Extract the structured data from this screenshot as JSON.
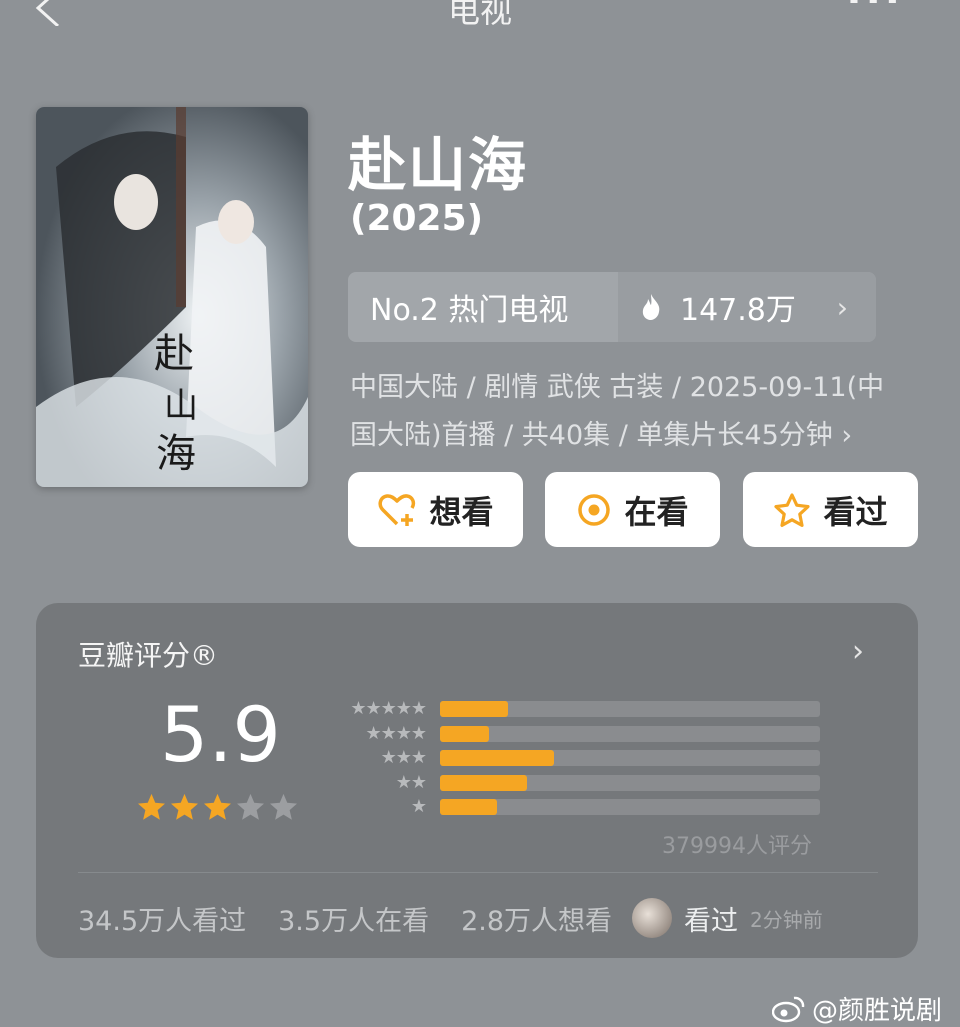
{
  "nav": {
    "title": "电视",
    "more": "···"
  },
  "show": {
    "title": "赴山海",
    "year": "(2025)",
    "rank": "No.2 热门电视",
    "heat": "147.8万",
    "meta_line1": "中国大陆 / 剧情 武侠 古装 / 2025-09-11(中",
    "meta_line2": "国大陆)首播 / 共40集 / 单集片长45分钟 ›"
  },
  "buttons": {
    "want": "想看",
    "watching": "在看",
    "watched": "看过"
  },
  "rating": {
    "label": "豆瓣评分®",
    "score": "5.9",
    "stars_filled": 3,
    "stars_total": 5,
    "distribution_percent": {
      "5": 18,
      "4": 13,
      "3": 30,
      "2": 23,
      "1": 15
    },
    "count": "379994人评分"
  },
  "stats": {
    "watched": "34.5万人看过",
    "watching": "3.5万人在看",
    "want": "2.8万人想看",
    "friend_action": "看过",
    "friend_time": "2分钟前"
  },
  "watermark": "@颜胜说剧",
  "colors": {
    "accent": "#f5a623",
    "background": "#8e9296",
    "card": "#75787b"
  }
}
